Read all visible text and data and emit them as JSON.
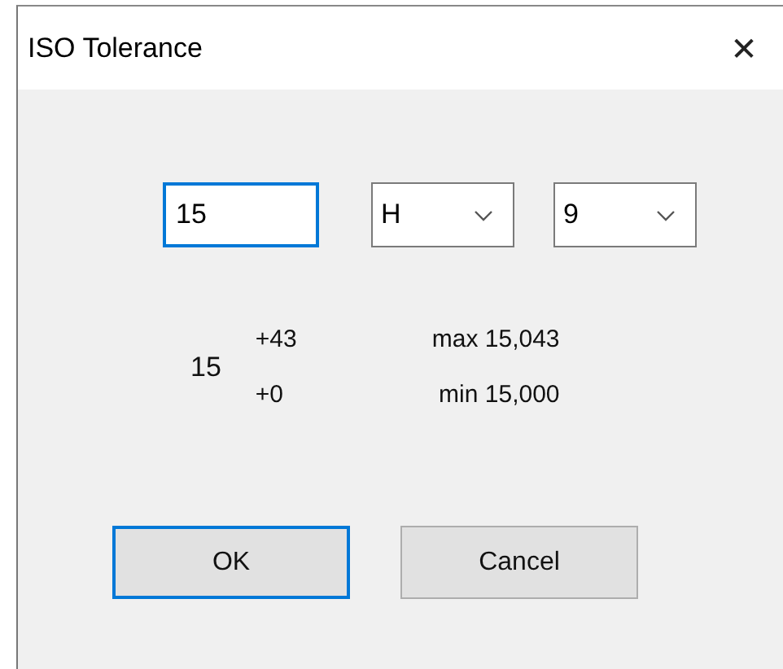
{
  "window": {
    "title": "ISO Tolerance",
    "close": "✕"
  },
  "size_field": {
    "value": "15",
    "focused": true
  },
  "dropdowns": [
    {
      "value": "H"
    },
    {
      "value": "9"
    }
  ],
  "result": {
    "nominal": "15",
    "upper_deviation": "+43",
    "lower_deviation": "+0",
    "max": "max 15,043",
    "min": "min 15,000"
  },
  "buttons": [
    {
      "label": "OK",
      "default": true
    },
    {
      "label": "Cancel",
      "default": false
    }
  ]
}
